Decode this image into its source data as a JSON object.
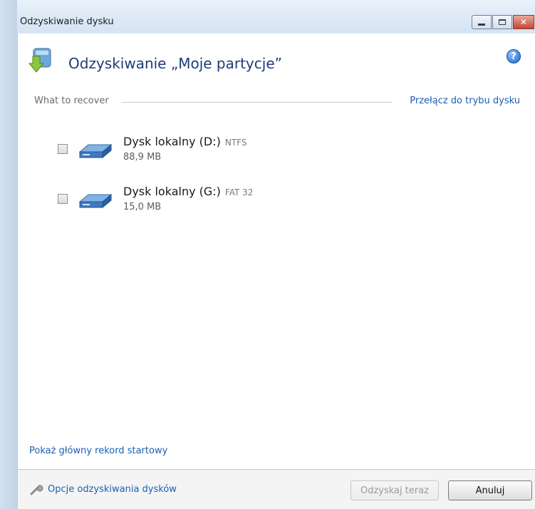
{
  "window": {
    "title": "Odzyskiwanie dysku",
    "controls": {
      "minimize_icon": "minimize-icon",
      "maximize_icon": "maximize-icon",
      "close_label": "✕"
    }
  },
  "header": {
    "title": "Odzyskiwanie „Moje partycje”",
    "icon": "disk-recovery-icon",
    "help_label": "?"
  },
  "section": {
    "label": "What to recover",
    "switch_link": "Przełącz do trybu dysku"
  },
  "disks": [
    {
      "name": "Dysk lokalny (D:)",
      "fs": "NTFS",
      "size": "88,9 MB",
      "checked": false
    },
    {
      "name": "Dysk lokalny (G:)",
      "fs": "FAT 32",
      "size": "15,0 MB",
      "checked": false
    }
  ],
  "mbr_link": "Pokaż główny rekord startowy",
  "footer": {
    "options_link": "Opcje odzyskiwania dysków",
    "recover_button": "Odzyskaj teraz",
    "recover_enabled": false,
    "cancel_button": "Anuluj"
  },
  "colors": {
    "link": "#1b5fb5",
    "title": "#1e3c78",
    "titlebar": "#dfeaf7"
  }
}
